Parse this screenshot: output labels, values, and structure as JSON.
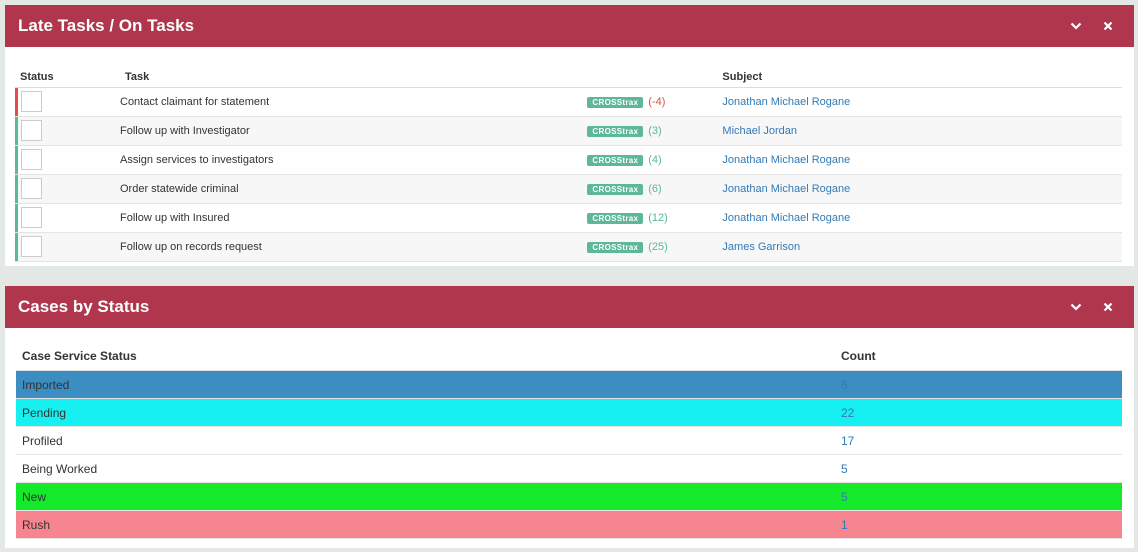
{
  "late_tasks_panel": {
    "title": "Late Tasks / On Tasks",
    "collapse_icon": "chevron-down-icon",
    "close_icon": "close-icon",
    "columns": {
      "status": "Status",
      "task": "Task",
      "subject": "Subject"
    },
    "rows": [
      {
        "status_color": "#e74c4c",
        "task": "Contact claimant for statement",
        "tag": "CROSStrax",
        "days": "(-4)",
        "late": true,
        "subject": "Jonathan Michael Rogane"
      },
      {
        "status_color": "#5cb897",
        "task": "Follow up with Investigator",
        "tag": "CROSStrax",
        "days": "(3)",
        "late": false,
        "subject": "Michael Jordan"
      },
      {
        "status_color": "#5cb897",
        "task": "Assign services to investigators",
        "tag": "CROSStrax",
        "days": "(4)",
        "late": false,
        "subject": "Jonathan Michael Rogane"
      },
      {
        "status_color": "#5cb897",
        "task": "Order statewide criminal",
        "tag": "CROSStrax",
        "days": "(6)",
        "late": false,
        "subject": "Jonathan Michael Rogane"
      },
      {
        "status_color": "#5cb897",
        "task": "Follow up with Insured",
        "tag": "CROSStrax",
        "days": "(12)",
        "late": false,
        "subject": "Jonathan Michael Rogane"
      },
      {
        "status_color": "#5cb897",
        "task": "Follow up on records request",
        "tag": "CROSStrax",
        "days": "(25)",
        "late": false,
        "subject": "James Garrison"
      }
    ]
  },
  "cases_panel": {
    "title": "Cases by Status",
    "collapse_icon": "chevron-down-icon",
    "close_icon": "close-icon",
    "columns": {
      "status": "Case Service Status",
      "count": "Count"
    },
    "rows": [
      {
        "status": "Imported",
        "count": "6",
        "bg": "#3b8dc2"
      },
      {
        "status": "Pending",
        "count": "22",
        "bg": "#16f0f0"
      },
      {
        "status": "Profiled",
        "count": "17",
        "bg": "#ffffff"
      },
      {
        "status": "Being Worked",
        "count": "5",
        "bg": "#ffffff"
      },
      {
        "status": "New",
        "count": "5",
        "bg": "#14ea2a"
      },
      {
        "status": "Rush",
        "count": "1",
        "bg": "#f78590"
      }
    ]
  },
  "colors": {
    "header_bg": "#b0364e",
    "tag_bg": "#5cb897",
    "link": "#337ab7"
  }
}
